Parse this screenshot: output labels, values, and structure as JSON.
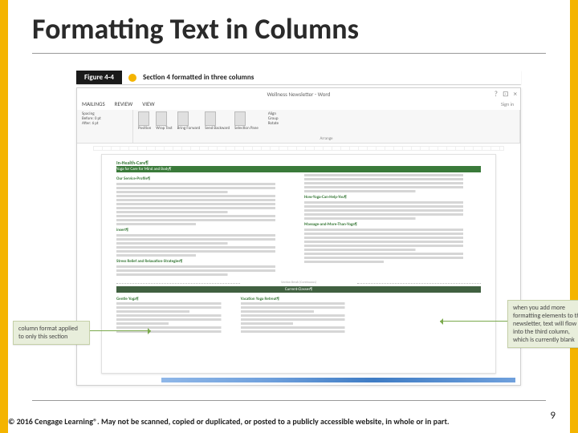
{
  "slide": {
    "title": "Formatting Text in Columns",
    "page_number": "9",
    "footer": "© 2016 Cengage Learning®. May not be scanned, copied or duplicated, or posted to a publicly accessible website, in whole or in part."
  },
  "figure": {
    "number": "Figure 4-4",
    "caption": "Section 4 formatted in three columns"
  },
  "word": {
    "window_title": "Wellness Newsletter - Word",
    "sign_in": "Sign in",
    "controls": {
      "help": "?",
      "min": "⊡",
      "close": "×"
    },
    "tabs": [
      "MAILINGS",
      "REVIEW",
      "VIEW"
    ],
    "spacing": {
      "label": "Spacing",
      "before_label": "Before:",
      "before_value": "0 pt",
      "after_label": "After:",
      "after_value": "6 pt"
    },
    "arrange": {
      "position": "Position",
      "wrap": "Wrap Text",
      "bring": "Bring Forward",
      "send": "Send Backward",
      "selection": "Selection Pane",
      "align": "Align",
      "group": "Group",
      "rotate": "Rotate",
      "label": "Arrange"
    }
  },
  "document": {
    "title": "In-Health-Care¶",
    "subtitle_bar": "Yoga for Care for Mind and Body¶",
    "section2_heading_a": "Our Service-Profile¶",
    "section2_note": "insert¶",
    "section2_heading_b": "Stress Relief and Relaxation-Strategies¶",
    "col2_heading_a": "How-Yoga-Can-Help-You¶",
    "col2_heading_b": "Massage-and-More-Than-Yoga¶",
    "section_break_label": "Section Break (Continuous)",
    "section4_bar": "Current·Classes¶",
    "col3_a": "Gentle Yoga¶",
    "col3_b": "Vacation Yoga Retreat¶",
    "col3_c": " "
  },
  "callouts": {
    "left": "column format applied to only this section",
    "right": "when you add more formatting elements to the newsletter, text will flow into the third column, which is currently blank"
  }
}
